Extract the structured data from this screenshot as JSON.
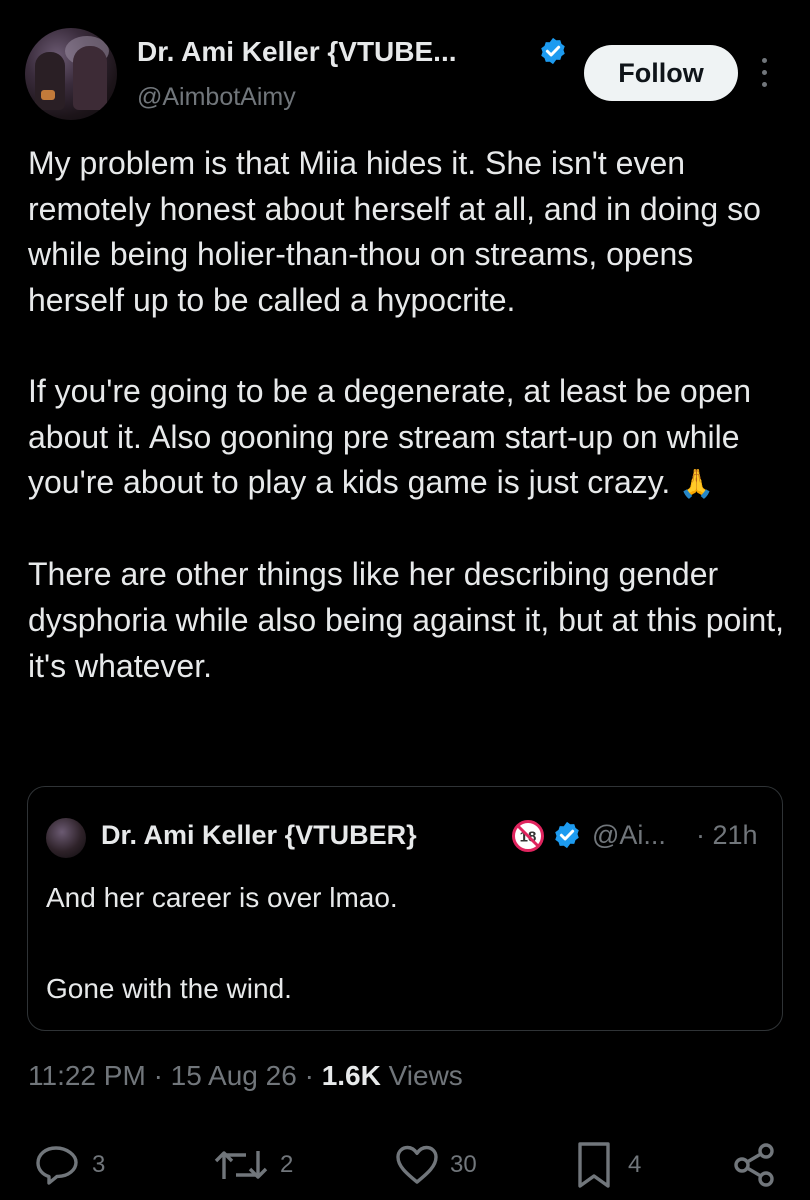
{
  "author": {
    "name": "Dr. Ami Keller {VTUBE...",
    "handle": "@AimbotAimy",
    "follow_label": "Follow"
  },
  "post": {
    "paragraphs": [
      "My problem is that Miia hides it. She isn't even remotely honest about herself at all, and in doing so while being holier-than-thou on streams, opens herself up to be called a hypocrite.",
      "If you're going to be a degenerate, at least be open about it. Also gooning pre stream start-up on while you're about to play a kids game is just crazy.",
      "There are other things like her describing gender dysphoria while also being against it, but at this point, it's whatever."
    ],
    "emoji": "🙏"
  },
  "quote": {
    "name": "Dr. Ami Keller {VTUBER}",
    "badge_18": "18",
    "handle": "@Ai...",
    "time": "· 21h",
    "line1": "And her career is over lmao.",
    "line2": "Gone with the wind."
  },
  "meta": {
    "time": "11:22 PM",
    "date": "15 Aug 26",
    "views_count": "1.6K",
    "views_label": "Views"
  },
  "actions": {
    "replies": "3",
    "reposts": "2",
    "likes": "30",
    "bookmarks": "4"
  },
  "colors": {
    "background": "#000000",
    "text": "#e7e9ea",
    "muted": "#71767b",
    "verified": "#1d9bf0",
    "border": "#2f3336"
  }
}
